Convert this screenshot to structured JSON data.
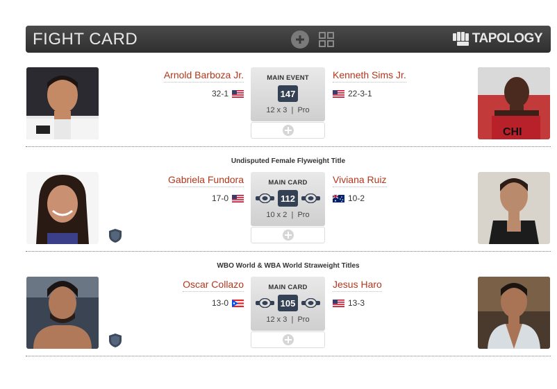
{
  "header": {
    "title": "FIGHT CARD",
    "logo_text": "TAPOLOGY"
  },
  "bouts": [
    {
      "title": "",
      "left": {
        "name": "Arnold Barboza Jr.",
        "record": "32-1",
        "flag": "us"
      },
      "right": {
        "name": "Kenneth Sims Jr.",
        "record": "22-3-1",
        "flag": "us"
      },
      "label": "MAIN EVENT",
      "weight": "147",
      "rounds": "12 x 3",
      "level": "Pro",
      "title_fight": false
    },
    {
      "title": "Undisputed Female Flyweight Title",
      "left": {
        "name": "Gabriela Fundora",
        "record": "17-0",
        "flag": "us"
      },
      "right": {
        "name": "Viviana Ruiz",
        "record": "10-2",
        "flag": "au"
      },
      "label": "MAIN CARD",
      "weight": "112",
      "rounds": "10 x 2",
      "level": "Pro",
      "title_fight": true
    },
    {
      "title": "WBO World & WBA World Straweight Titles",
      "left": {
        "name": "Oscar Collazo",
        "record": "13-0",
        "flag": "pr"
      },
      "right": {
        "name": "Jesus Haro",
        "record": "13-3",
        "flag": "us"
      },
      "label": "MAIN CARD",
      "weight": "105",
      "rounds": "12 x 3",
      "level": "Pro",
      "title_fight": true
    }
  ],
  "separator": "|",
  "colors": {
    "header_bg": "#3a3a3a",
    "name_link": "#b3361b",
    "weight_badge": "#344154",
    "shield": "#3d4a5c"
  },
  "icons": {
    "header_add": "plus-circle-icon",
    "header_grid": "grid-icon",
    "logo": "tapology-fist-icon",
    "belt": "championship-belt-icon",
    "title": "shield-icon",
    "add": "plus-circle-icon"
  }
}
